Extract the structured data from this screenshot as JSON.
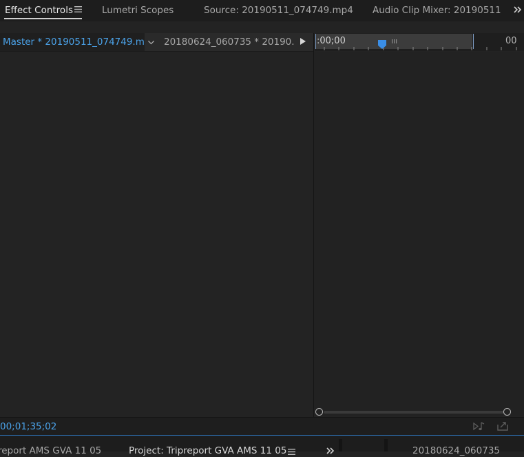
{
  "tabs": {
    "effect_controls": "Effect Controls",
    "lumetri": "Lumetri Scopes",
    "source": "Source: 20190511_074749.mp4",
    "mixer": "Audio Clip Mixer: 20190511",
    "overflow_icon": "double-chevron-right-icon",
    "menu_icon": "hamburger-menu-icon"
  },
  "header": {
    "master_label": "Master * 20190511_074749.m...",
    "clip_label": "20180624_060735 * 20190...",
    "chevron_icon": "chevron-down-icon",
    "play_icon": "play-triangle-icon"
  },
  "ruler": {
    "start_time": ":00;00",
    "end_time": "00"
  },
  "footer": {
    "timecode": "00;01;35;02",
    "play_audio_icon": "play-audio-icon",
    "export_icon": "export-frame-icon"
  },
  "bottom_tabs": {
    "ams": "report AMS GVA 11 05",
    "project": "Project: Tripreport GVA AMS 11 05",
    "clip": "20180624_060735"
  },
  "colors": {
    "accent_blue": "#4ba3ea",
    "panel_bg": "#232323",
    "tabbar_bg": "#1d1d1d"
  }
}
